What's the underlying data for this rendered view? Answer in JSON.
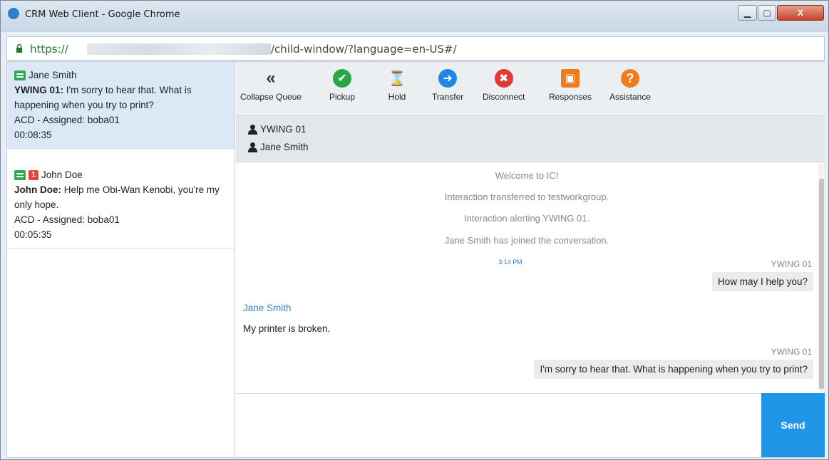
{
  "window": {
    "title": "CRM Web Client - Google Chrome",
    "minimize_icon": "minimize-icon",
    "maximize_icon": "maximize-icon",
    "close_label": "X"
  },
  "address": {
    "scheme": "https://",
    "path": "/child-window/?language=en-US#/"
  },
  "queue": [
    {
      "name": "Jane Smith",
      "badge": "",
      "speaker": "YWING 01:",
      "message": " I'm sorry to hear that. What is happening when you try to print?",
      "status": "ACD - Assigned: boba01",
      "time": "00:08:35",
      "active": true
    },
    {
      "name": "John Doe",
      "badge": "1",
      "speaker": "John Doe:",
      "message": " Help me Obi-Wan Kenobi, you're my only hope.",
      "status": "ACD - Assigned: boba01",
      "time": "00:05:35",
      "active": false
    }
  ],
  "toolbar": [
    {
      "label": "Collapse Queue",
      "icon": "double-chevron-left-icon",
      "glyph": "«",
      "color": "transparent",
      "fg": "#333"
    },
    {
      "label": "Pickup",
      "icon": "check-circle-icon",
      "glyph": "✔",
      "color": "#27a844",
      "fg": "#fff"
    },
    {
      "label": "Hold",
      "icon": "hourglass-icon",
      "glyph": "⌛",
      "color": "transparent",
      "fg": "#555"
    },
    {
      "label": "Transfer",
      "icon": "arrow-right-circle-icon",
      "glyph": "➜",
      "color": "#1e88e5",
      "fg": "#fff"
    },
    {
      "label": "Disconnect",
      "icon": "close-circle-icon",
      "glyph": "✖",
      "color": "#e53935",
      "fg": "#fff"
    },
    {
      "label": "Responses",
      "icon": "responses-icon",
      "glyph": "▣",
      "color": "#f07b1b",
      "fg": "#fff"
    },
    {
      "label": "Assistance",
      "icon": "help-icon",
      "glyph": "?",
      "color": "#f07b1b",
      "fg": "#fff"
    }
  ],
  "participants": [
    "YWING 01",
    "Jane Smith"
  ],
  "transcript": {
    "system": [
      "Welcome to IC!",
      "Interaction transferred to testworkgroup.",
      "Interaction alerting YWING 01.",
      "Jane Smith has joined the conversation."
    ],
    "timestamp": "3:14 PM",
    "agent1_name": "YWING 01",
    "agent1_msg": "How may I help you?",
    "customer_name": "Jane Smith",
    "customer_msg": "My printer is broken.",
    "agent2_name": "YWING 01",
    "agent2_msg": "I'm sorry to hear that.  What is happening when you try to print?"
  },
  "compose": {
    "send_label": "Send",
    "placeholder": ""
  },
  "colors": {
    "accent": "#2196e9",
    "active_queue": "#dbe9f7",
    "link": "#3a80c9"
  }
}
